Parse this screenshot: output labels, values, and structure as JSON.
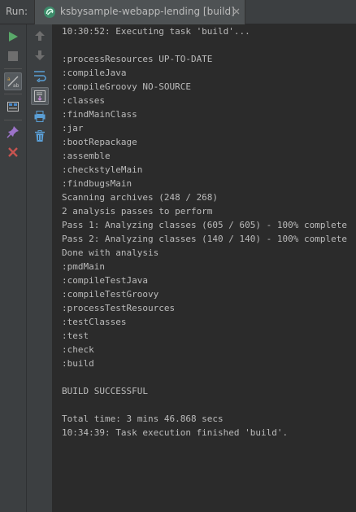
{
  "header": {
    "run_label": "Run:",
    "tab_title": "ksbysample-webapp-lending [build]"
  },
  "toolbar_left": [
    {
      "name": "run-icon",
      "color": "#59a869"
    },
    {
      "name": "stop-icon",
      "color": "#6e6e6e"
    },
    {
      "name": "sort-icon",
      "color": "#c0c0c0"
    },
    {
      "name": "layout-icon",
      "color": "#c0c0c0"
    },
    {
      "name": "pin-icon",
      "color": "#9b59b6"
    },
    {
      "name": "close-icon",
      "color": "#c75450"
    }
  ],
  "toolbar_right": [
    {
      "name": "arrow-up-icon"
    },
    {
      "name": "arrow-down-icon"
    },
    {
      "name": "soft-wrap-icon"
    },
    {
      "name": "scroll-to-end-icon"
    },
    {
      "name": "print-icon"
    },
    {
      "name": "trash-icon"
    }
  ],
  "console": {
    "lines": [
      "10:30:52: Executing task 'build'...",
      "",
      ":processResources UP-TO-DATE",
      ":compileJava",
      ":compileGroovy NO-SOURCE",
      ":classes",
      ":findMainClass",
      ":jar",
      ":bootRepackage",
      ":assemble",
      ":checkstyleMain",
      ":findbugsMain",
      "Scanning archives (248 / 268)",
      "2 analysis passes to perform",
      "Pass 1: Analyzing classes (605 / 605) - 100% complete",
      "Pass 2: Analyzing classes (140 / 140) - 100% complete",
      "Done with analysis",
      ":pmdMain",
      ":compileTestJava",
      ":compileTestGroovy",
      ":processTestResources",
      ":testClasses",
      ":test",
      ":check",
      ":build",
      "",
      "BUILD SUCCESSFUL",
      "",
      "Total time: 3 mins 46.868 secs",
      "10:34:39: Task execution finished 'build'."
    ]
  }
}
